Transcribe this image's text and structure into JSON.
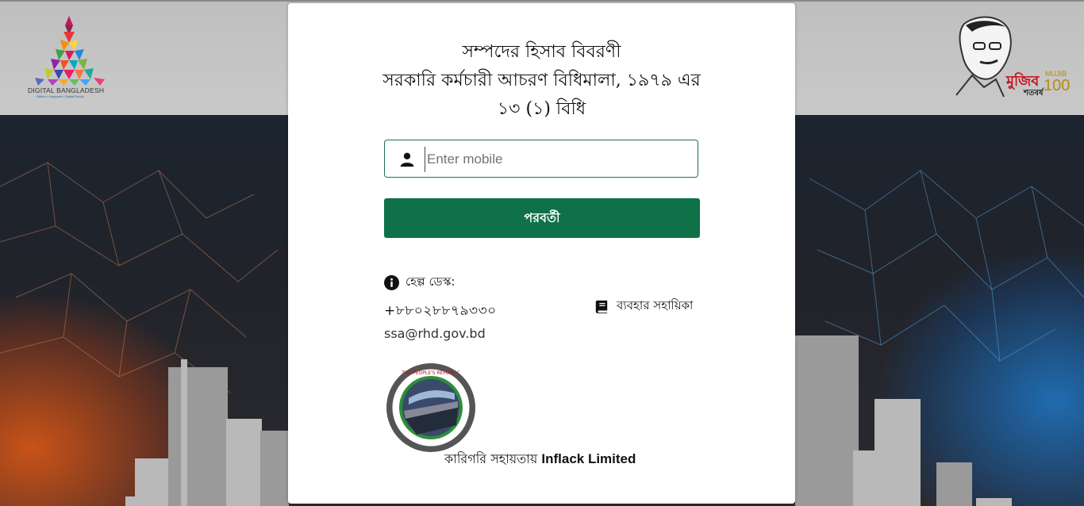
{
  "header": {
    "left_logo_text": "DIGITAL BANGLADESH",
    "left_logo_tagline": "Skilled • Equipped • Digital Ready",
    "right_logo_text": "মুজিব",
    "right_logo_sub": "শতবর্ষ",
    "right_logo_en": "MUJIB",
    "right_logo_num": "100"
  },
  "form": {
    "title_line1": "সম্পদের হিসাব বিবরণী",
    "title_line2": "সরকারি কর্মচারী আচরণ বিধিমালা, ১৯৭৯ এর",
    "title_line3": "১৩ (১) বিধি",
    "mobile_placeholder": "Enter mobile",
    "mobile_value": "",
    "next_label": "পরবর্তী"
  },
  "help": {
    "label": "হেল্প ডেস্ক:",
    "phone": "+৮৮০২৮৮৭৯৩৩০",
    "email": "ssa@rhd.gov.bd",
    "manual_label": "ব্যবহার সহায়িকা"
  },
  "footer": {
    "credit_prefix": "কারিগরি সহায়তায়",
    "credit_company": "Inflack Limited",
    "logo_ring_text": "ROADS AND HIGHWAYS DEPARTMENT",
    "logo_ring_text2": "THE PEOPLE'S REPUBLIC OF BANGLADESH"
  },
  "colors": {
    "primary": "#0e7148",
    "input_border": "#1f6e55",
    "mujib_red": "#c0121b"
  },
  "icons": {
    "user": "user-icon",
    "info": "info-icon",
    "book": "book-icon"
  }
}
